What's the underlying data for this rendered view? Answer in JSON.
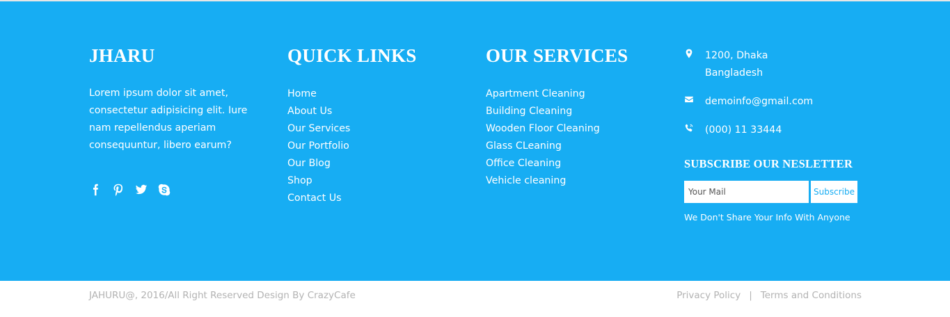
{
  "about": {
    "title": "JHARU",
    "text": "Lorem ipsum dolor sit amet, consectetur adipisicing elit. Iure nam repellendus aperiam consequuntur, libero earum?",
    "social": [
      "facebook-icon",
      "pinterest-icon",
      "twitter-icon",
      "skype-icon"
    ]
  },
  "quick_links": {
    "title": "QUICK LINKS",
    "items": [
      "Home",
      "About Us",
      "Our Services",
      "Our Portfolio",
      "Our Blog",
      "Shop",
      "Contact Us"
    ]
  },
  "services": {
    "title": "OUR SERVICES",
    "items": [
      "Apartment Cleaning",
      "Building Cleaning",
      "Wooden Floor Cleaning",
      "Glass CLeaning",
      "Office Cleaning",
      "Vehicle cleaning"
    ]
  },
  "contact": {
    "address_line1": "1200, Dhaka",
    "address_line2": "Bangladesh",
    "email": "demoinfo@gmail.com",
    "phone": "(000) 11 33444"
  },
  "newsletter": {
    "title": "SUBSCRIBE OUR NESLETTER",
    "placeholder": "Your Mail",
    "button": "Subscribe",
    "note": "We Don't Share Your Info With Anyone"
  },
  "bottom": {
    "copyright": "JAHURU@, 2016/All Right Reserved Design By CrazyCafe",
    "privacy": "Privacy Policy",
    "separator": "|",
    "terms": "Terms and Conditions"
  },
  "colors": {
    "primary": "#17adf3",
    "bottom_text": "#b3b3b3"
  }
}
